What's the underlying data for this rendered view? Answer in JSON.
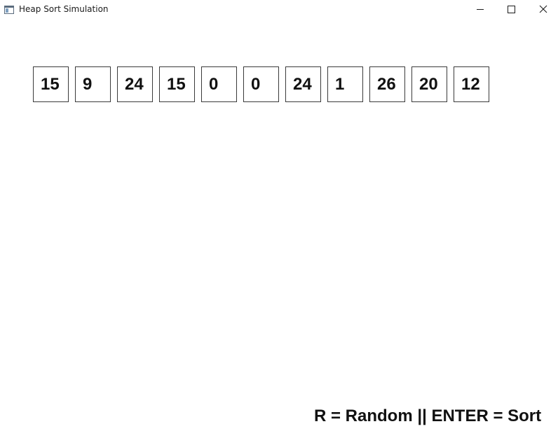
{
  "window": {
    "title": "Heap Sort Simulation",
    "icon": "app-window-icon",
    "controls": {
      "minimize": "minimize-icon",
      "maximize": "maximize-icon",
      "close": "close-icon"
    }
  },
  "array": {
    "values": [
      "15",
      "9",
      "24",
      "15",
      "0",
      "0",
      "24",
      "1",
      "26",
      "20",
      "12"
    ]
  },
  "footer": {
    "hint": "R = Random || ENTER = Sort"
  }
}
